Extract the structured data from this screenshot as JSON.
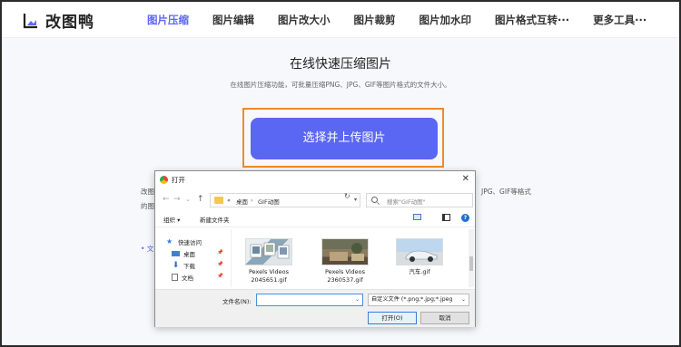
{
  "header": {
    "logo_text": "改图鸭",
    "nav": [
      {
        "label": "图片压缩",
        "active": true
      },
      {
        "label": "图片编辑",
        "active": false
      },
      {
        "label": "图片改大小",
        "active": false
      },
      {
        "label": "图片裁剪",
        "active": false
      },
      {
        "label": "图片加水印",
        "active": false
      },
      {
        "label": "图片格式互转···",
        "active": false
      },
      {
        "label": "更多工具···",
        "active": false
      }
    ]
  },
  "main": {
    "title": "在线快速压缩图片",
    "subtitle": "在线图片压缩功能，可批量压缩PNG、JPG、GIF等图片格式的文件大小。",
    "upload_button": "选择并上传图片",
    "behind_text_left_1": "改图",
    "behind_text_left_2": "的图",
    "behind_text_right": "JPG、GIF等格式",
    "bullet": "• 文"
  },
  "dialog": {
    "title": "打开",
    "close": "✕",
    "address": {
      "prefix": "«",
      "segments": [
        "桌面",
        "GIF动图"
      ]
    },
    "search_placeholder": "搜索\"GIF动图\"",
    "toolbar": {
      "organize": "组织 ▾",
      "new_folder": "新建文件夹",
      "help": "?"
    },
    "tree": [
      {
        "label": "快速访问",
        "icon": "star-icon"
      },
      {
        "label": "桌面",
        "icon": "desktop-folder-icon",
        "pinned": true
      },
      {
        "label": "下载",
        "icon": "download-icon",
        "pinned": true
      },
      {
        "label": "文档",
        "icon": "document-icon",
        "pinned": true
      }
    ],
    "files": [
      {
        "name_line1": "Pexels Videos",
        "name_line2": "2045651.gif"
      },
      {
        "name_line1": "Pexels Videos",
        "name_line2": "2360537.gif"
      },
      {
        "name_line1": "汽车.gif",
        "name_line2": ""
      }
    ],
    "filename_label": "文件名(N):",
    "filename_value": "",
    "filetype_value": "自定义文件 (*.png;*.jpg;*.jpeg",
    "open_button": "打开(O)",
    "cancel_button": "取消"
  },
  "colors": {
    "accent": "#5a67f2",
    "highlight_outline": "#f08a2c"
  }
}
